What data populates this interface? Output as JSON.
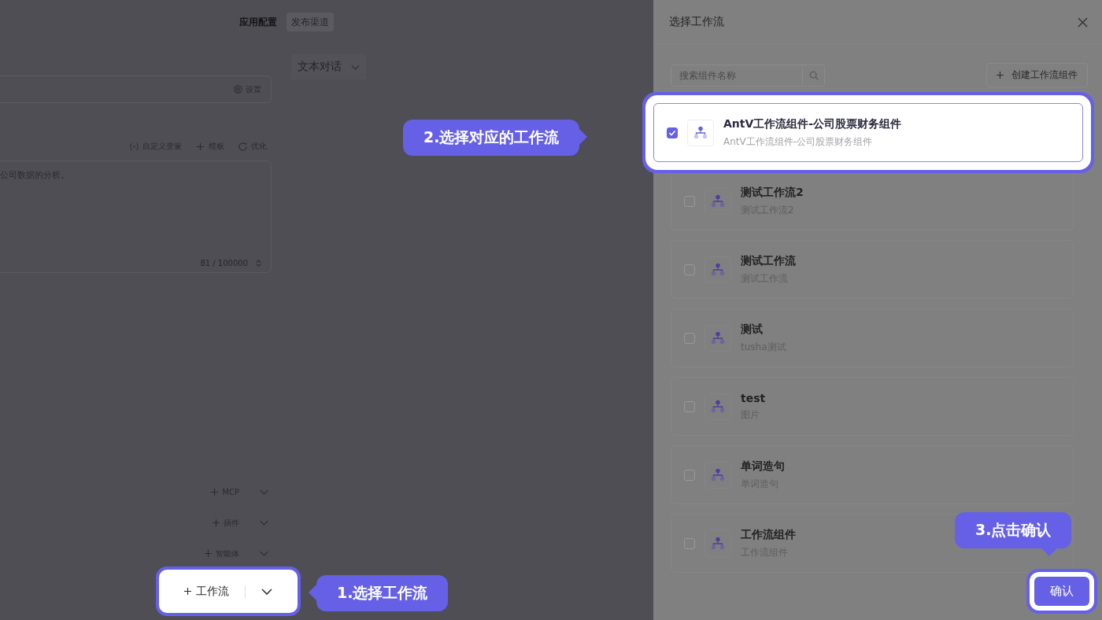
{
  "app_tabs": [
    {
      "label": "应用配置",
      "selected": true
    },
    {
      "label": "发布渠道",
      "selected": false
    }
  ],
  "mode_select": {
    "value": "文本对话"
  },
  "settings_bar": {
    "button": "设置"
  },
  "prompt_toolbar": [
    {
      "label": "自定义变量",
      "kind": "variable"
    },
    {
      "label": "模板",
      "kind": "plus"
    },
    {
      "label": "优化",
      "kind": "magic"
    }
  ],
  "prompt": {
    "value": "公司数据的分析。",
    "counter": "81 / 100000"
  },
  "add_sections": [
    {
      "label": "MCP"
    },
    {
      "label": "插件"
    },
    {
      "label": "智能体"
    }
  ],
  "workflow_button": {
    "label": "工作流",
    "highlighted": true
  },
  "drawer": {
    "title": "选择工作流",
    "search": {
      "placeholder": "搜索组件名称"
    },
    "create_button": "创建工作流组件",
    "items": [
      {
        "name": "AntV工作流组件-公司股票财务组件",
        "description": "AntV工作流组件-公司股票财务组件",
        "checked": true,
        "highlighted": true
      },
      {
        "name": "测试工作流2",
        "description": "测试工作流2",
        "checked": false,
        "highlighted": false
      },
      {
        "name": "测试工作流",
        "description": "测试工作流",
        "checked": false,
        "highlighted": false
      },
      {
        "name": "测试",
        "description": "tusha测试",
        "checked": false,
        "highlighted": false
      },
      {
        "name": "test",
        "description": "图片",
        "checked": false,
        "highlighted": false
      },
      {
        "name": "单词造句",
        "description": "单词造句",
        "checked": false,
        "highlighted": false
      },
      {
        "name": "工作流组件",
        "description": "工作流组件",
        "checked": false,
        "highlighted": false
      }
    ],
    "confirm_button": {
      "label": "确认",
      "highlighted": true
    }
  },
  "callouts": [
    {
      "text": "2.选择对应的工作流",
      "kind": "right"
    },
    {
      "text": "1.选择工作流",
      "kind": "left"
    },
    {
      "text": "3.点击确认",
      "kind": "down"
    }
  ]
}
